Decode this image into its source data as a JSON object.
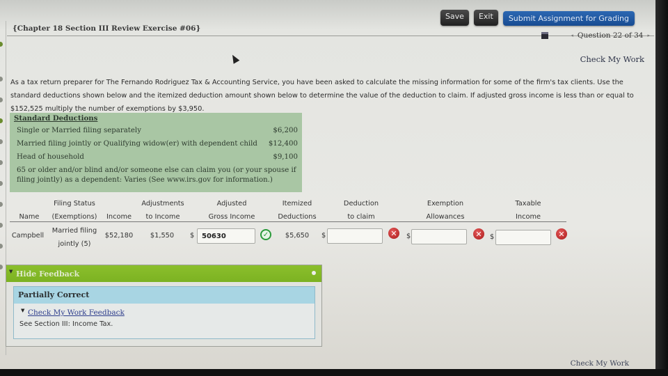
{
  "toolbar": {
    "save_label": "Save",
    "exit_label": "Exit",
    "submit_label": "Submit Assignment for Grading"
  },
  "header": {
    "exercise_title": "{Chapter 18 Section III Review Exercise #06}",
    "question_nav": "Question 22 of 34",
    "prev_arrow": "◂",
    "next_arrow": "▸",
    "calculator_icon": "calculator-icon"
  },
  "check_my_work_label": "Check My Work",
  "instructions": "As a tax return preparer for The Fernando Rodriguez Tax & Accounting Service, you have been asked to calculate the missing information for some of the firm's tax clients. Use the standard deductions shown below and the itemized deduction amount shown below to determine the value of the deduction to claim. If adjusted gross income is less than or equal to $152,525 multiply the number of exemptions by $3,950.",
  "standard_deductions": {
    "title": "Standard Deductions",
    "rows": [
      {
        "label": "Single or Married filing separately",
        "amount": "$6,200"
      },
      {
        "label": "Married filing jointly or Qualifying widow(er) with dependent child",
        "amount": "$12,400"
      },
      {
        "label": "Head of household",
        "amount": "$9,100"
      }
    ],
    "note": "65 or older and/or blind and/or someone else can claim you (or your spouse if filing jointly) as a dependent: Varies (See www.irs.gov for information.)"
  },
  "table": {
    "headers": [
      {
        "line1": "",
        "line2": "Name"
      },
      {
        "line1": "Filing Status",
        "line2": "(Exemptions)"
      },
      {
        "line1": "",
        "line2": "Income"
      },
      {
        "line1": "Adjustments",
        "line2": "to Income"
      },
      {
        "line1": "Adjusted",
        "line2": "Gross Income"
      },
      {
        "line1": "Itemized",
        "line2": "Deductions"
      },
      {
        "line1": "Deduction",
        "line2": "to claim"
      },
      {
        "line1": "Exemption",
        "line2": "Allowances"
      },
      {
        "line1": "Taxable",
        "line2": "Income"
      }
    ],
    "row": {
      "name": "Campbell",
      "filing_status_line1": "Married filing",
      "filing_status_line2": "jointly (5)",
      "income": "$52,180",
      "adjustments": "$1,550",
      "currency": "$",
      "agi_value": "50630",
      "agi_status": "correct",
      "itemized": "$5,650",
      "deduction_value": "",
      "deduction_status": "incorrect",
      "exemption_value": "",
      "exemption_status": "incorrect",
      "taxable_value": "",
      "taxable_status": "incorrect"
    }
  },
  "feedback": {
    "toggle_label": "Hide Feedback",
    "status": "Partially Correct",
    "link_label": "Check My Work Feedback",
    "note": "See Section III: Income Tax."
  },
  "colors": {
    "submit_blue": "#1f5aa3",
    "feedback_green": "#7cb222",
    "feedback_head_blue": "#a8d5e3",
    "std_box_green": "#a9c6a4",
    "correct_green": "#2a9a3a",
    "incorrect_red": "#a91818"
  }
}
